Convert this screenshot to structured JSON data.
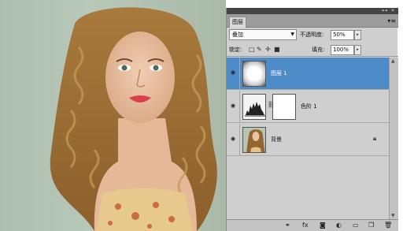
{
  "panel": {
    "tab_label": "图层",
    "collapse_glyph": "◂◂",
    "close_glyph": "×",
    "menu_glyph": "▾≡",
    "blend_mode": "叠加",
    "opacity_label": "不透明度:",
    "opacity_value": "50%",
    "lock_label": "锁定:",
    "fill_label": "填充:",
    "fill_value": "100%"
  },
  "layers": [
    {
      "name": "图层 1",
      "selected": true,
      "thumb_icon": "white-radial-mask"
    },
    {
      "name": "色阶 1",
      "selected": false,
      "thumb_icon": "levels-histogram-icon"
    },
    {
      "name": "背景",
      "selected": false,
      "thumb_icon": "photo-thumbnail",
      "locked": true
    }
  ],
  "colors": {
    "selection": "#4d8bc9",
    "panel_bg": "#cfcfcf",
    "title_bar": "#454545"
  },
  "bottom_icons": [
    "link-icon",
    "fx-icon",
    "mask-icon",
    "adjustment-icon",
    "group-icon",
    "new-layer-icon",
    "trash-icon"
  ]
}
